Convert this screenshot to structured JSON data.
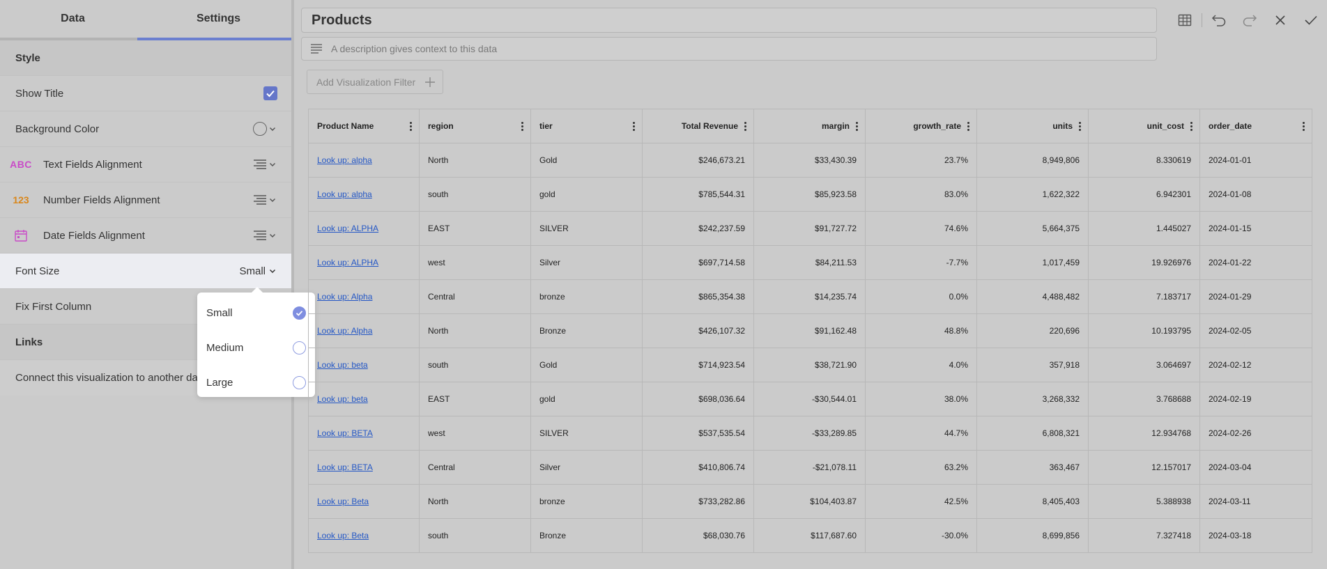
{
  "left_panel": {
    "tabs": [
      {
        "label": "Data",
        "active": false
      },
      {
        "label": "Settings",
        "active": true
      }
    ],
    "style_section": "Style",
    "show_title": {
      "label": "Show Title",
      "checked": true
    },
    "background_color": {
      "label": "Background Color"
    },
    "text_fields_alignment": {
      "icon_text": "ABC",
      "label": "Text Fields Alignment"
    },
    "number_fields_alignment": {
      "icon_text": "123",
      "label": "Number Fields Alignment"
    },
    "date_fields_alignment": {
      "label": "Date Fields Alignment"
    },
    "font_size": {
      "label": "Font Size",
      "value": "Small"
    },
    "fix_first_column": {
      "label": "Fix First Column"
    },
    "links_section": "Links",
    "links_text": "Connect this visualization to another dash"
  },
  "font_size_popup": {
    "options": [
      {
        "label": "Small",
        "selected": true
      },
      {
        "label": "Medium",
        "selected": false
      },
      {
        "label": "Large",
        "selected": false
      }
    ]
  },
  "header": {
    "title": "Products",
    "description_placeholder": "A description gives context to this data",
    "filter_button": "Add Visualization Filter"
  },
  "toolbar": {
    "icons": [
      "table-icon",
      "undo-icon",
      "redo-icon",
      "close-icon",
      "check-icon"
    ]
  },
  "table": {
    "columns": [
      "Product Name",
      "region",
      "tier",
      "Total Revenue",
      "margin",
      "growth_rate",
      "units",
      "unit_cost",
      "order_date"
    ],
    "rows": [
      [
        "Look up: alpha",
        "North",
        "Gold",
        "$246,673.21",
        "$33,430.39",
        "23.7%",
        "8,949,806",
        "8.330619",
        "2024-01-01"
      ],
      [
        "Look up: alpha",
        "south",
        "gold",
        "$785,544.31",
        "$85,923.58",
        "83.0%",
        "1,622,322",
        "6.942301",
        "2024-01-08"
      ],
      [
        "Look up: ALPHA",
        "EAST",
        "SILVER",
        "$242,237.59",
        "$91,727.72",
        "74.6%",
        "5,664,375",
        "1.445027",
        "2024-01-15"
      ],
      [
        "Look up: ALPHA",
        "west",
        "Silver",
        "$697,714.58",
        "$84,211.53",
        "-7.7%",
        "1,017,459",
        "19.926976",
        "2024-01-22"
      ],
      [
        "Look up: Alpha",
        "Central",
        "bronze",
        "$865,354.38",
        "$14,235.74",
        "0.0%",
        "4,488,482",
        "7.183717",
        "2024-01-29"
      ],
      [
        "Look up: Alpha",
        "North",
        "Bronze",
        "$426,107.32",
        "$91,162.48",
        "48.8%",
        "220,696",
        "10.193795",
        "2024-02-05"
      ],
      [
        "Look up: beta",
        "south",
        "Gold",
        "$714,923.54",
        "$38,721.90",
        "4.0%",
        "357,918",
        "3.064697",
        "2024-02-12"
      ],
      [
        "Look up: beta",
        "EAST",
        "gold",
        "$698,036.64",
        "-$30,544.01",
        "38.0%",
        "3,268,332",
        "3.768688",
        "2024-02-19"
      ],
      [
        "Look up: BETA",
        "west",
        "SILVER",
        "$537,535.54",
        "-$33,289.85",
        "44.7%",
        "6,808,321",
        "12.934768",
        "2024-02-26"
      ],
      [
        "Look up: BETA",
        "Central",
        "Silver",
        "$410,806.74",
        "-$21,078.11",
        "63.2%",
        "363,467",
        "12.157017",
        "2024-03-04"
      ],
      [
        "Look up: Beta",
        "North",
        "bronze",
        "$733,282.86",
        "$104,403.87",
        "42.5%",
        "8,405,403",
        "5.388938",
        "2024-03-11"
      ],
      [
        "Look up: Beta",
        "south",
        "Bronze",
        "$68,030.76",
        "$117,687.60",
        "-30.0%",
        "8,699,856",
        "7.327418",
        "2024-03-18"
      ]
    ]
  },
  "colors": {
    "accent": "#6b7fcf",
    "link": "#2457c5",
    "abc_icon": "#c94bc8",
    "num_icon": "#d9861a",
    "date_icon": "#c94bc8"
  }
}
